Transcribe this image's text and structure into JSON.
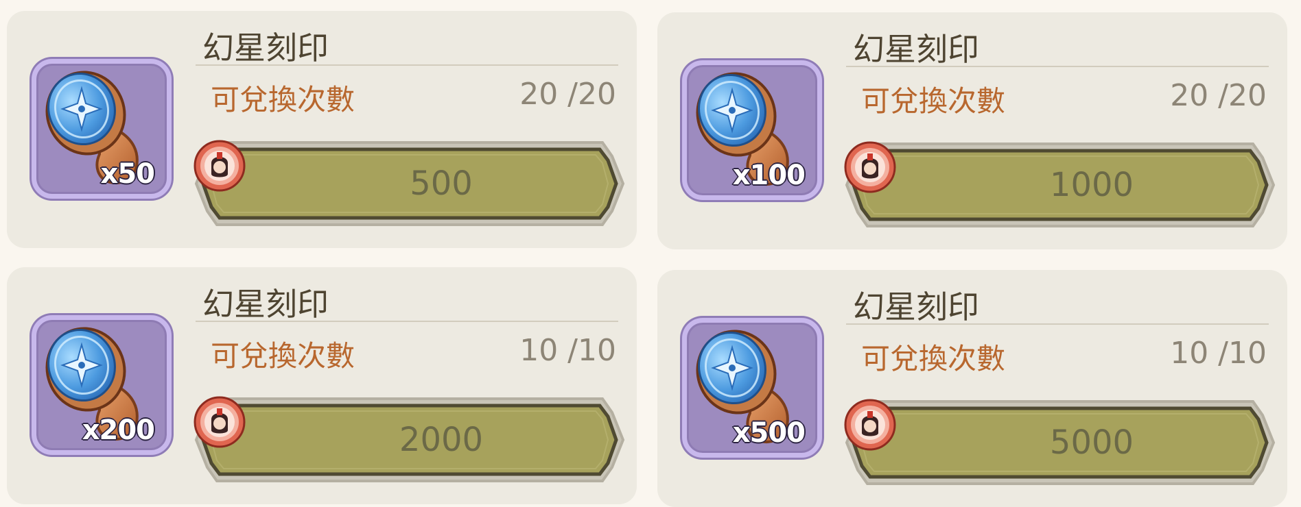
{
  "items": [
    {
      "title": "幻星刻印",
      "quantity": "x50",
      "limit_label": "可兌換次數",
      "limit_value": "20 /20",
      "price": "500"
    },
    {
      "title": "幻星刻印",
      "quantity": "x100",
      "limit_label": "可兌換次數",
      "limit_value": "20 /20",
      "price": "1000"
    },
    {
      "title": "幻星刻印",
      "quantity": "x200",
      "limit_label": "可兌換次數",
      "limit_value": "10 /10",
      "price": "2000"
    },
    {
      "title": "幻星刻印",
      "quantity": "x500",
      "limit_label": "可兌換次數",
      "limit_value": "10 /10",
      "price": "5000"
    }
  ],
  "icons": {
    "item": "star-seal-stamp-icon",
    "currency": "character-coin-icon"
  },
  "colors": {
    "card_bg": "#edeae1",
    "button_fill": "#a7a25c",
    "label_orange": "#b8672e",
    "icon_frame": "#9d8bbf"
  }
}
